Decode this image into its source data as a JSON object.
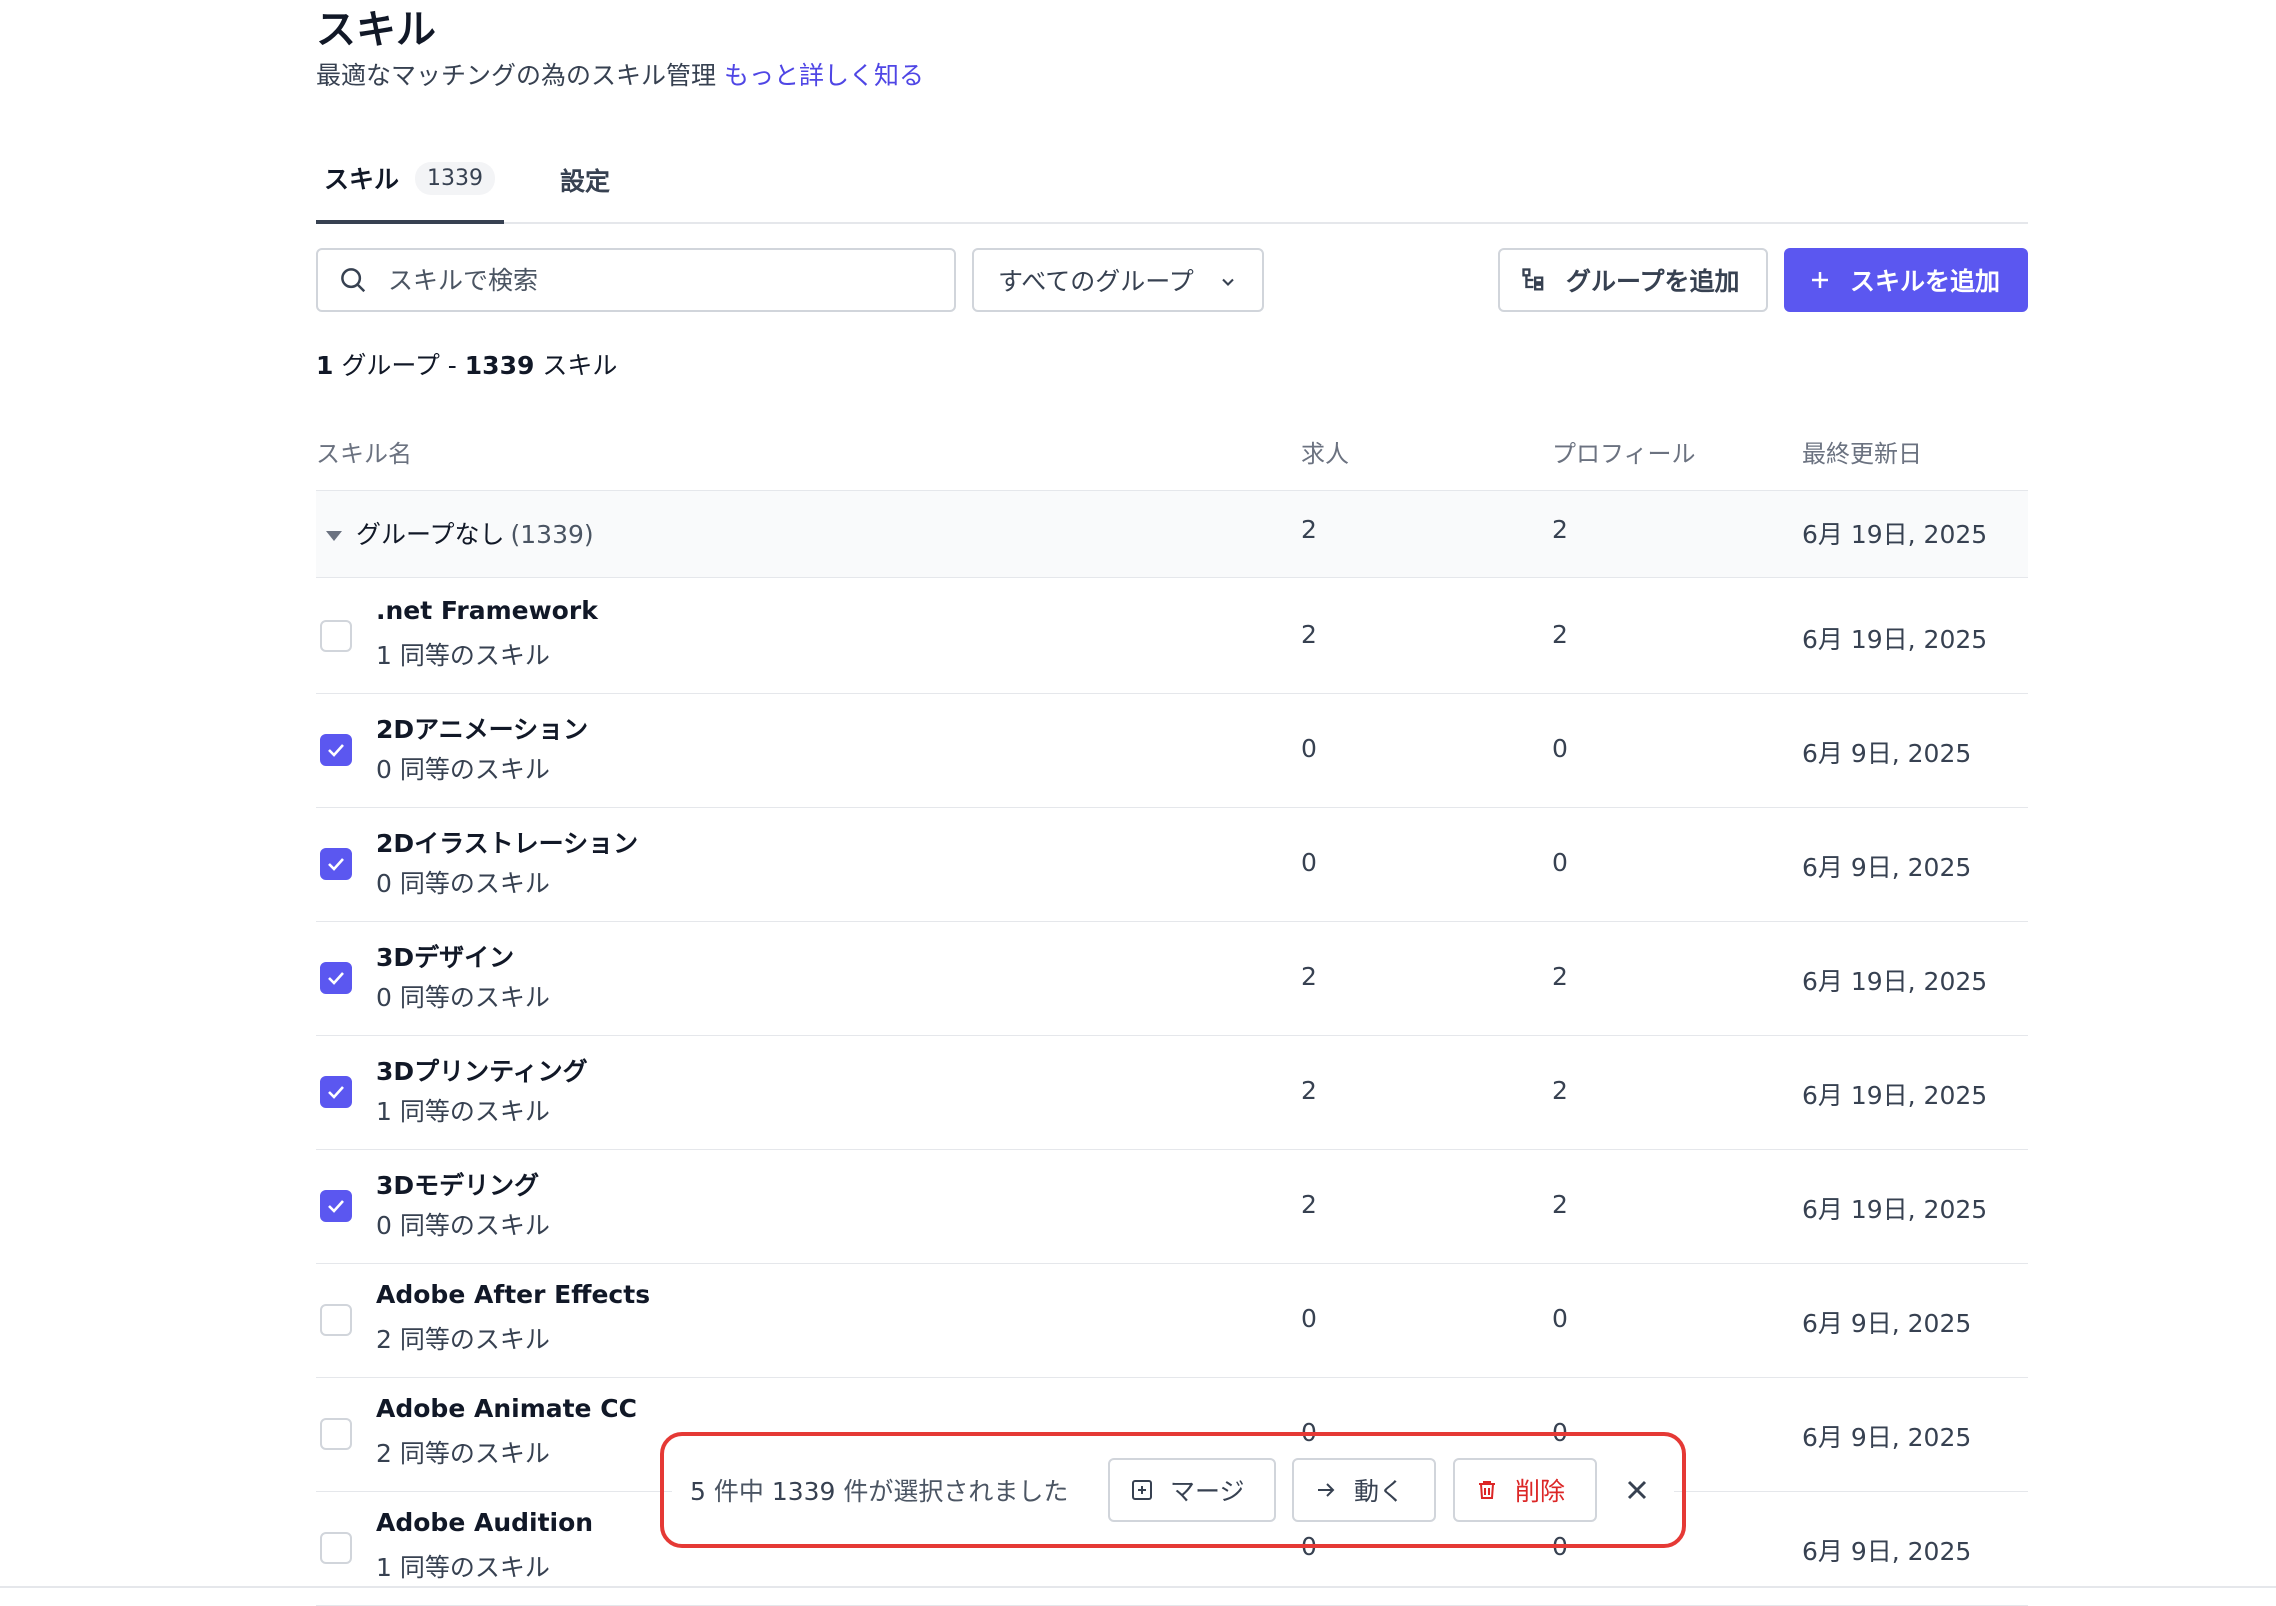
{
  "header": {
    "title": "スキル",
    "subtitle": "最適なマッチングの為のスキル管理",
    "learn_more": "もっと詳しく知る"
  },
  "tabs": [
    {
      "label": "スキル",
      "badge": "1339",
      "active": true
    },
    {
      "label": "設定",
      "active": false
    }
  ],
  "toolbar": {
    "search_placeholder": "スキルで検索",
    "group_filter": "すべてのグループ",
    "add_group_label": "グループを追加",
    "add_skill_label": "スキルを追加"
  },
  "summary": {
    "groups": "1",
    "groups_label": "グループ -",
    "skills": "1339",
    "skills_label": "スキル"
  },
  "table": {
    "columns": [
      "スキル名",
      "求人",
      "プロフィール",
      "最終更新日"
    ],
    "group": {
      "name": "グループなし",
      "count": "(1339)",
      "jobs": "2",
      "profiles": "2",
      "updated": "6月 19日, 2025"
    },
    "rows": [
      {
        "name": ".net Framework",
        "equivalents": "1 同等のスキル",
        "jobs": "2",
        "profiles": "2",
        "updated": "6月 19日, 2025",
        "checked": false
      },
      {
        "name": "2Dアニメーション",
        "equivalents": "0 同等のスキル",
        "jobs": "0",
        "profiles": "0",
        "updated": "6月 9日, 2025",
        "checked": true
      },
      {
        "name": "2Dイラストレーション",
        "equivalents": "0 同等のスキル",
        "jobs": "0",
        "profiles": "0",
        "updated": "6月 9日, 2025",
        "checked": true
      },
      {
        "name": "3Dデザイン",
        "equivalents": "0 同等のスキル",
        "jobs": "2",
        "profiles": "2",
        "updated": "6月 19日, 2025",
        "checked": true
      },
      {
        "name": "3Dプリンティング",
        "equivalents": "1 同等のスキル",
        "jobs": "2",
        "profiles": "2",
        "updated": "6月 19日, 2025",
        "checked": true
      },
      {
        "name": "3Dモデリング",
        "equivalents": "0 同等のスキル",
        "jobs": "2",
        "profiles": "2",
        "updated": "6月 19日, 2025",
        "checked": true
      },
      {
        "name": "Adobe After Effects",
        "equivalents": "2 同等のスキル",
        "jobs": "0",
        "profiles": "0",
        "updated": "6月 9日, 2025",
        "checked": false
      },
      {
        "name": "Adobe Animate CC",
        "equivalents": "2 同等のスキル",
        "jobs": "0",
        "profiles": "0",
        "updated": "6月 9日, 2025",
        "checked": false
      },
      {
        "name": "Adobe Audition",
        "equivalents": "1 同等のスキル",
        "jobs": "0",
        "profiles": "0",
        "updated": "6月 9日, 2025",
        "checked": false
      }
    ]
  },
  "bulk_bar": {
    "selected_count": "5",
    "middle": "件中",
    "total": "1339",
    "suffix": "件が選択されました",
    "merge_label": "マージ",
    "move_label": "動く",
    "delete_label": "削除"
  },
  "colors": {
    "accent": "#5b57f0",
    "link": "#4f46e5",
    "danger": "#dc2626",
    "highlight_frame": "#e53935"
  }
}
